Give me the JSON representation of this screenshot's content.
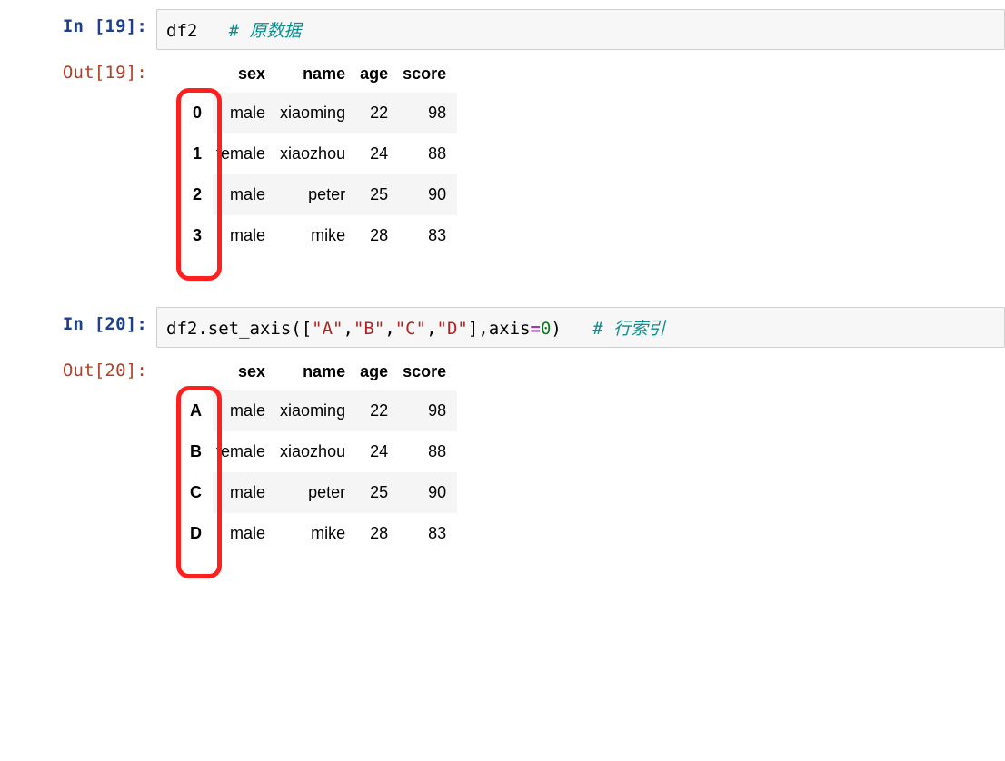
{
  "cell1": {
    "promptIn": "In [19]:",
    "promptOut": "Out[19]:",
    "code": {
      "var": "df2",
      "comment": "# 原数据"
    },
    "table": {
      "headers": [
        "sex",
        "name",
        "age",
        "score"
      ],
      "index": [
        "0",
        "1",
        "2",
        "3"
      ],
      "rows": [
        [
          "male",
          "xiaoming",
          "22",
          "98"
        ],
        [
          "female",
          "xiaozhou",
          "24",
          "88"
        ],
        [
          "male",
          "peter",
          "25",
          "90"
        ],
        [
          "male",
          "mike",
          "28",
          "83"
        ]
      ]
    }
  },
  "cell2": {
    "promptIn": "In [20]:",
    "promptOut": "Out[20]:",
    "code": {
      "var": "df2",
      "method": ".set_axis(",
      "lb": "[",
      "s1": "\"A\"",
      "c1": ",",
      "s2": "\"B\"",
      "c2": ",",
      "s3": "\"C\"",
      "c3": ",",
      "s4": "\"D\"",
      "rb": "]",
      "c4": ",",
      "kw": "axis",
      "eq": "=",
      "num": "0",
      "close": ")",
      "comment": "# 行索引"
    },
    "table": {
      "headers": [
        "sex",
        "name",
        "age",
        "score"
      ],
      "index": [
        "A",
        "B",
        "C",
        "D"
      ],
      "rows": [
        [
          "male",
          "xiaoming",
          "22",
          "98"
        ],
        [
          "female",
          "xiaozhou",
          "24",
          "88"
        ],
        [
          "male",
          "peter",
          "25",
          "90"
        ],
        [
          "male",
          "mike",
          "28",
          "83"
        ]
      ]
    }
  }
}
